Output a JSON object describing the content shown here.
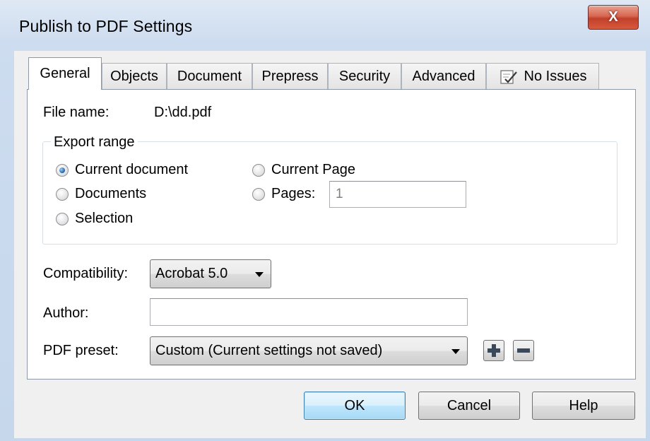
{
  "window": {
    "title": "Publish to PDF Settings",
    "close_label": "X"
  },
  "tabs": [
    {
      "label": "General"
    },
    {
      "label": "Objects"
    },
    {
      "label": "Document"
    },
    {
      "label": "Prepress"
    },
    {
      "label": "Security"
    },
    {
      "label": "Advanced"
    },
    {
      "label": "No Issues",
      "icon": "checklist-icon"
    }
  ],
  "general": {
    "file_name_label": "File name:",
    "file_name_value": "D:\\dd.pdf",
    "export_range": {
      "title": "Export range",
      "options": {
        "current_document": "Current document",
        "documents": "Documents",
        "selection": "Selection",
        "current_page": "Current Page",
        "pages": "Pages:"
      },
      "selected": "current_document",
      "pages_value": "1"
    },
    "compatibility_label": "Compatibility:",
    "compatibility_value": "Acrobat 5.0",
    "author_label": "Author:",
    "author_value": "",
    "preset_label": "PDF preset:",
    "preset_value": "Custom (Current settings not saved)"
  },
  "buttons": {
    "ok": "OK",
    "cancel": "Cancel",
    "help": "Help"
  },
  "colors": {
    "accent": "#3c7fb1",
    "close": "#c2402a"
  }
}
